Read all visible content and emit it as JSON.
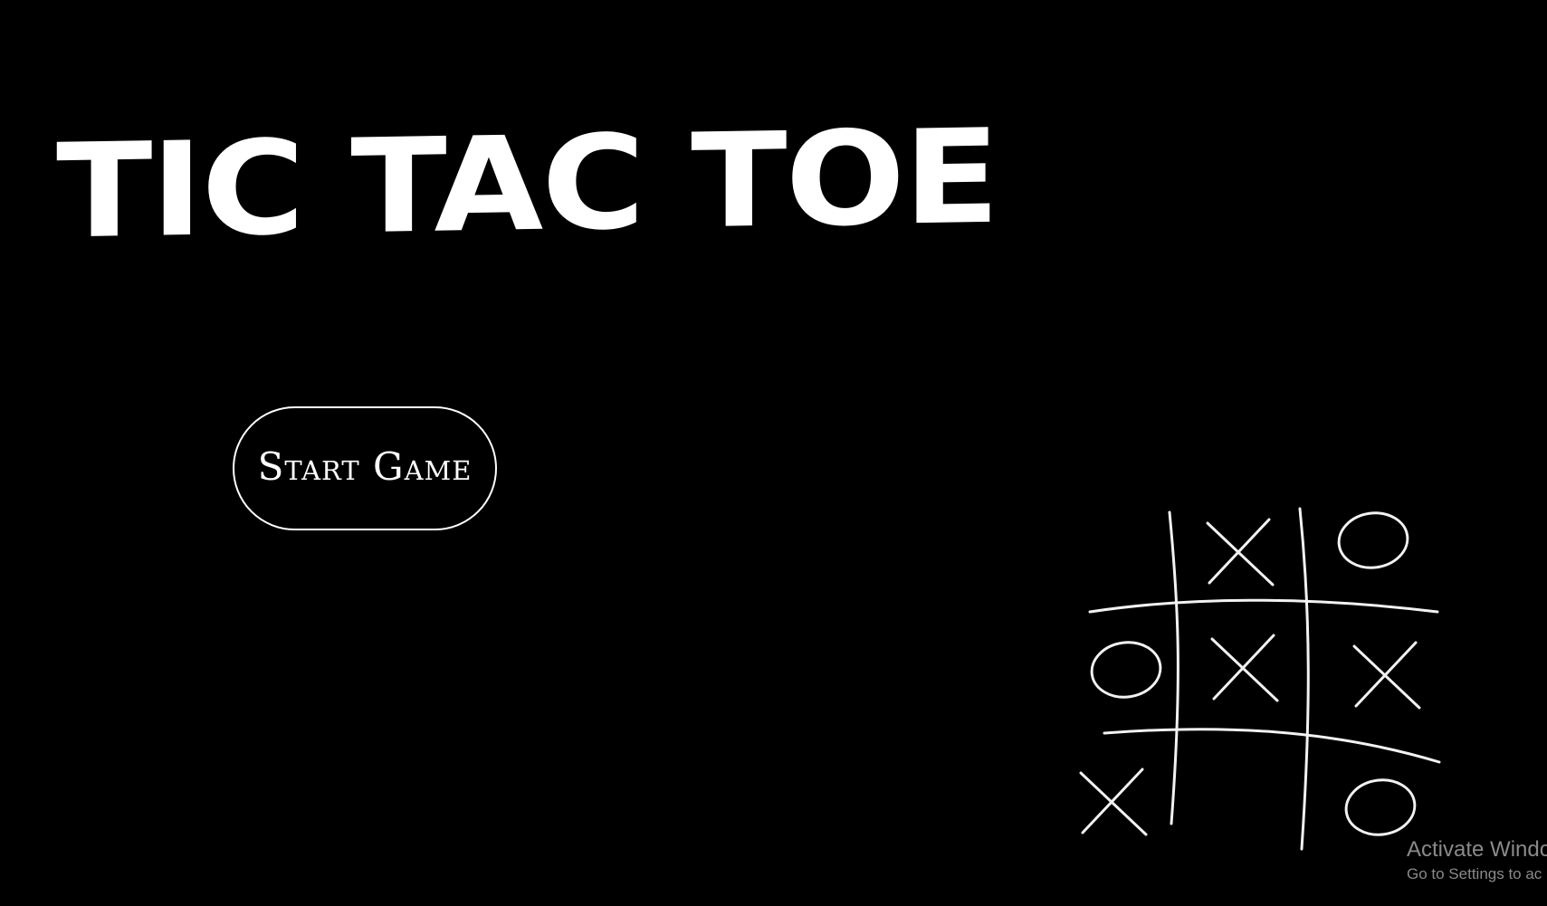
{
  "menu": {
    "title": "TIC TAC TOE",
    "start_button_label": "Start Game"
  },
  "board_illustration": {
    "cells": [
      [
        "",
        "X",
        "O"
      ],
      [
        "O",
        "X",
        "X"
      ],
      [
        "X",
        "",
        "O"
      ]
    ]
  },
  "os_watermark": {
    "title": "Activate Windo",
    "subtitle": "Go to Settings to ac"
  },
  "colors": {
    "background": "#000000",
    "foreground": "#ffffff",
    "watermark": "#8a8a8a"
  },
  "icons": {
    "board": "tic-tac-toe-board-icon"
  }
}
